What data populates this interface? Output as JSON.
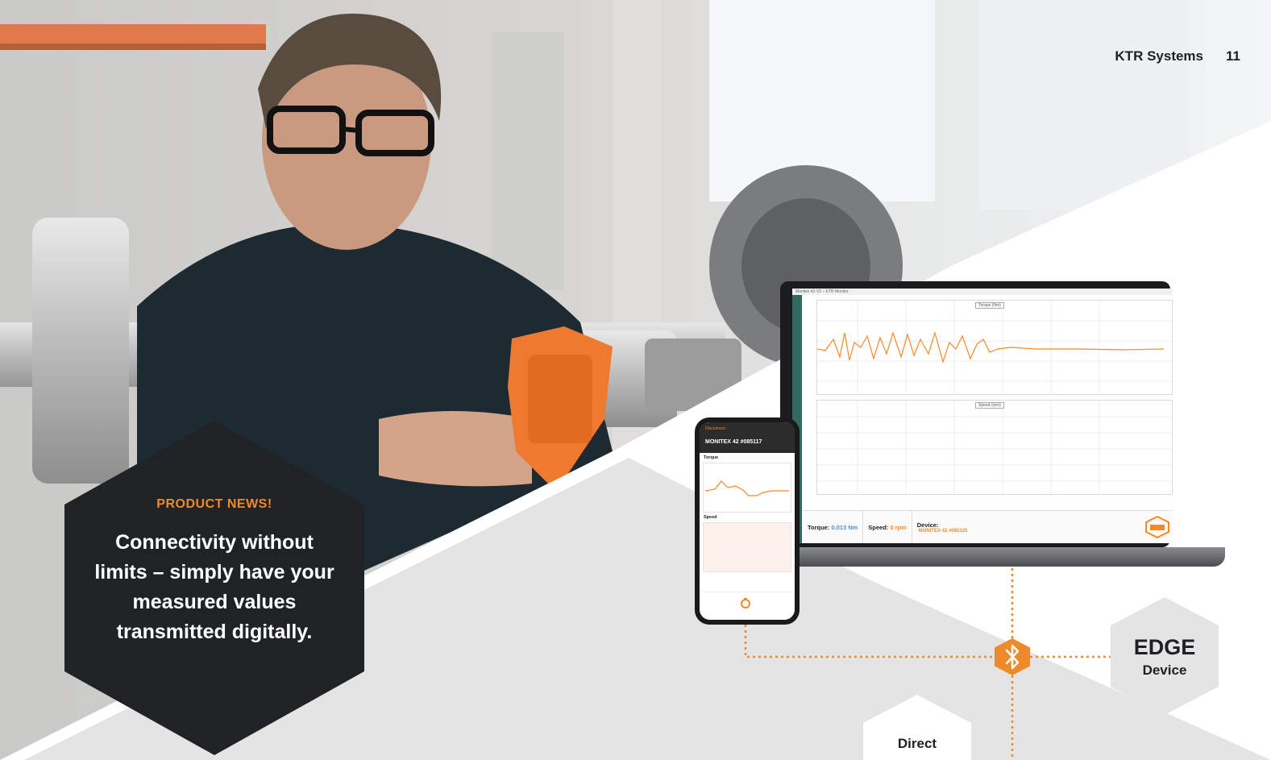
{
  "header": {
    "brand": "KTR Systems",
    "page_number": "11"
  },
  "callout": {
    "label": "PRODUCT NEWS!",
    "headline": "Connectivity without limits – simply have your measured values transmitted digitally."
  },
  "diagram": {
    "edge_title": "EDGE",
    "edge_subtitle": "Device",
    "direct_label": "Direct",
    "connector_icon": "bluetooth-icon",
    "accent_color": "#ef8a2b"
  },
  "laptop_app": {
    "window_title": "Monitex 42 V2 – KTR Monitor",
    "chart1_tag": "Torque (Nm)",
    "chart2_tag": "Speed (rpm)",
    "torque_label": "Torque:",
    "torque_value": "0.013 Nm",
    "speed_label": "Speed:",
    "speed_value": "0 rpm",
    "device_label": "Device:",
    "device_value": "MONITEX 42 #085125"
  },
  "phone_app": {
    "status": "Disconnect",
    "device_name": "MONITEX 42 #085117",
    "torque_label": "Torque",
    "speed_label": "Speed"
  },
  "colors": {
    "dark": "#1d2124",
    "accent": "#ef8a2b",
    "light_gray": "#e3e3e3"
  }
}
